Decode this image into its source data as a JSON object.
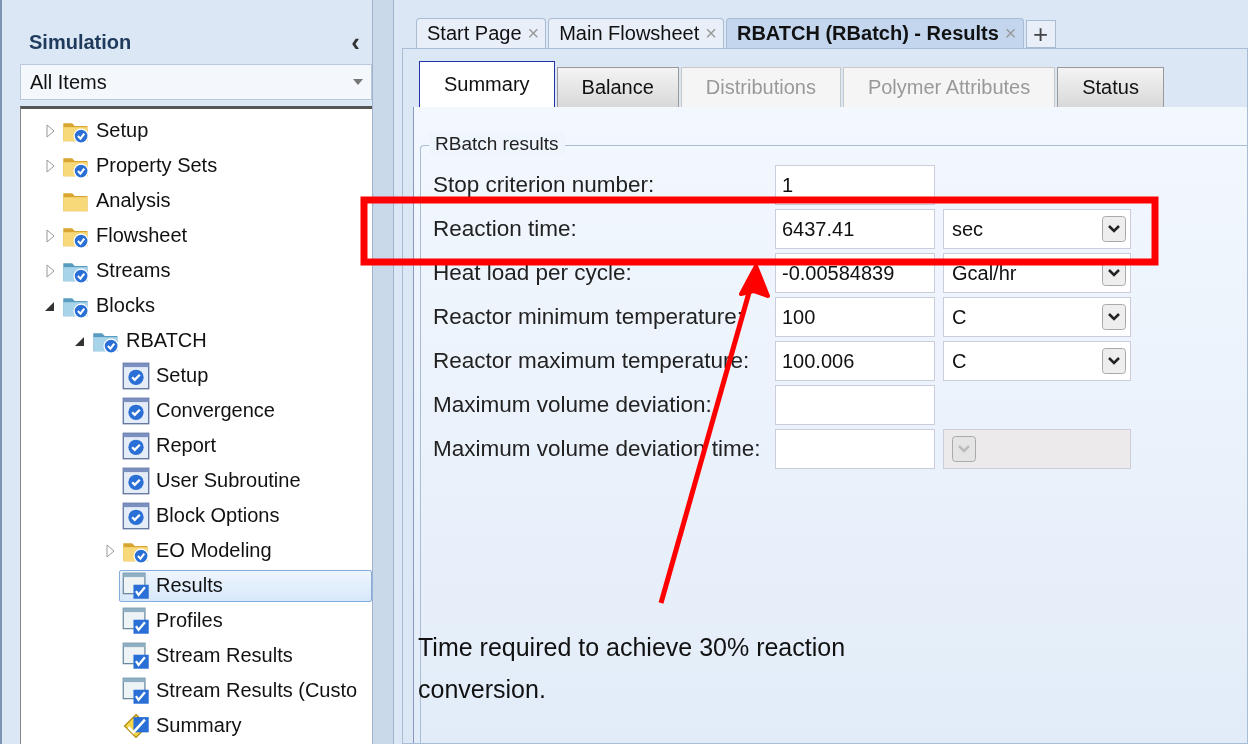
{
  "sidebar": {
    "title": "Simulation",
    "collapse_glyph": "‹",
    "filter": "All Items",
    "tree": [
      {
        "label": "Setup",
        "kind": "folder",
        "checked": true,
        "expanded": false
      },
      {
        "label": "Property Sets",
        "kind": "folder",
        "checked": true,
        "expanded": false
      },
      {
        "label": "Analysis",
        "kind": "folder",
        "checked": false
      },
      {
        "label": "Flowsheet",
        "kind": "folder",
        "checked": true,
        "expanded": false
      },
      {
        "label": "Streams",
        "kind": "blue-folder",
        "checked": true,
        "expanded": false
      },
      {
        "label": "Blocks",
        "kind": "blue-folder",
        "checked": true,
        "expanded": true,
        "children": [
          {
            "label": "RBATCH",
            "kind": "blue-folder",
            "checked": true,
            "expanded": true,
            "children": [
              {
                "label": "Setup",
                "kind": "form",
                "checked": true,
                "selected": false
              },
              {
                "label": "Convergence",
                "kind": "form",
                "checked": true,
                "selected": false
              },
              {
                "label": "Report",
                "kind": "form",
                "checked": true,
                "selected": false
              },
              {
                "label": "User Subroutine",
                "kind": "form",
                "checked": true,
                "selected": false
              },
              {
                "label": "Block Options",
                "kind": "form",
                "checked": true,
                "selected": false
              },
              {
                "label": "EO Modeling",
                "kind": "folder",
                "checked": true,
                "expanded": false,
                "selected": false
              },
              {
                "label": "Results",
                "kind": "results",
                "checked": true,
                "selected": true
              },
              {
                "label": "Profiles",
                "kind": "results",
                "checked": true,
                "selected": false
              },
              {
                "label": "Stream Results",
                "kind": "results",
                "checked": true,
                "selected": false
              },
              {
                "label": "Stream Results (Custo",
                "kind": "results",
                "checked": true,
                "selected": false
              },
              {
                "label": "Summary",
                "kind": "summary",
                "checked": true,
                "selected": false
              }
            ]
          }
        ]
      }
    ]
  },
  "doc_tabs": [
    {
      "label": "Start Page",
      "selected": false
    },
    {
      "label": "Main Flowsheet",
      "selected": false
    },
    {
      "label": "RBATCH (RBatch) - Results",
      "selected": true
    }
  ],
  "new_tab_glyph": "+",
  "close_glyph": "×",
  "form_tabs": [
    {
      "label": "Summary",
      "selected": true,
      "disabled": false
    },
    {
      "label": "Balance",
      "selected": false,
      "disabled": false
    },
    {
      "label": "Distributions",
      "selected": false,
      "disabled": true
    },
    {
      "label": "Polymer Attributes",
      "selected": false,
      "disabled": true
    },
    {
      "label": "Status",
      "selected": false,
      "disabled": false
    }
  ],
  "group": {
    "title": "RBatch results",
    "rows": [
      {
        "label": "Stop criterion number:",
        "kind": "value",
        "value": "1"
      },
      {
        "label": "Reaction time:",
        "kind": "value-unit",
        "value": "6437.41",
        "unit": "sec"
      },
      {
        "label": "Heat load per cycle:",
        "kind": "value-unit",
        "value": "-0.00584839",
        "unit": "Gcal/hr"
      },
      {
        "label": "Reactor minimum temperature:",
        "kind": "value-unit",
        "value": "100",
        "unit": "C"
      },
      {
        "label": "Reactor maximum temperature:",
        "kind": "value-unit",
        "value": "100.006",
        "unit": "C"
      },
      {
        "label": "Maximum volume deviation:",
        "kind": "value"
      },
      {
        "label": "Maximum volume deviation time:",
        "kind": "value-disabled-unit"
      }
    ]
  },
  "annotation": {
    "note": "Time required to achieve 30% reaction conversion."
  }
}
